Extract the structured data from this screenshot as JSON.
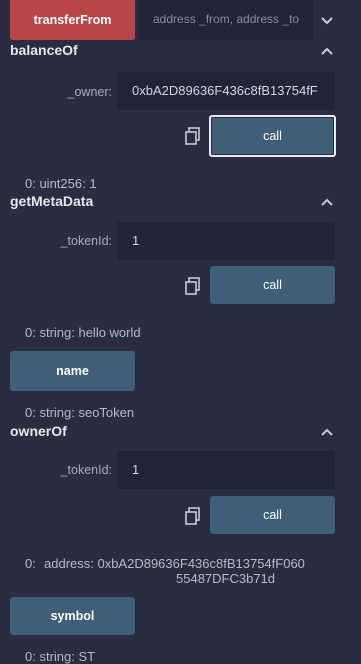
{
  "transferFrom": {
    "button_label": "transferFrom",
    "placeholder": "address _from, address _to"
  },
  "balanceOf": {
    "title": "balanceOf",
    "param_label": "_owner:",
    "param_value": "0xbA2D89636F436c8fB13754fF",
    "call_label": "call",
    "output": "0: uint256: 1"
  },
  "getMetaData": {
    "title": "getMetaData",
    "param_label": "_tokenId:",
    "param_value": "1",
    "call_label": "call",
    "output": "0: string: hello world"
  },
  "name": {
    "button_label": "name",
    "output": "0: string: seoToken"
  },
  "ownerOf": {
    "title": "ownerOf",
    "param_label": "_tokenId:",
    "param_value": "1",
    "call_label": "call",
    "output_prefix": "0:",
    "output_line1": "address: 0xbA2D89636F436c8fB13754fF060",
    "output_line2": "55487DFC3b71d"
  },
  "symbol": {
    "button_label": "symbol",
    "output": "0: string: ST"
  },
  "icons": {
    "expand": "chevron-down-icon",
    "collapse": "chevron-up-icon",
    "copy": "copy-icon"
  },
  "colors": {
    "background": "#2a2c3f",
    "input": "#222336",
    "call_button": "#3f5e79",
    "transact_button": "#b94548"
  }
}
